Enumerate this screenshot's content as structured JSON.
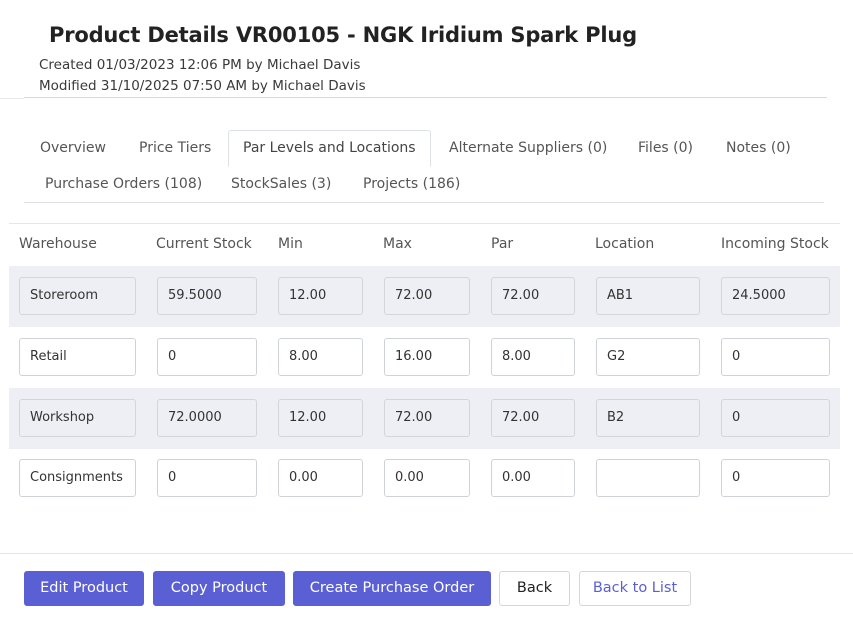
{
  "header": {
    "title": "Product Details VR00105 - NGK Iridium Spark Plug",
    "created": "Created 01/03/2023 12:06 PM by Michael Davis",
    "modified": "Modified 31/10/2025 07:50 AM by Michael Davis"
  },
  "tabs": [
    {
      "label": "Overview"
    },
    {
      "label": "Price Tiers"
    },
    {
      "label": "Par Levels and Locations",
      "active": true
    },
    {
      "label": "Alternate Suppliers (0)"
    },
    {
      "label": "Files (0)"
    },
    {
      "label": "Notes (0)"
    },
    {
      "label": "Purchase Orders (108)"
    },
    {
      "label": "StockSales (3)"
    },
    {
      "label": "Projects (186)"
    }
  ],
  "table": {
    "headers": [
      "Warehouse",
      "Current Stock",
      "Min",
      "Max",
      "Par",
      "Location",
      "Incoming Stock"
    ],
    "rows": [
      {
        "warehouse": "Storeroom",
        "current_stock": "59.5000",
        "min": "12.00",
        "max": "72.00",
        "par": "72.00",
        "location": "AB1",
        "incoming": "24.5000"
      },
      {
        "warehouse": "Retail",
        "current_stock": "0",
        "min": "8.00",
        "max": "16.00",
        "par": "8.00",
        "location": "G2",
        "incoming": "0"
      },
      {
        "warehouse": "Workshop",
        "current_stock": "72.0000",
        "min": "12.00",
        "max": "72.00",
        "par": "72.00",
        "location": "B2",
        "incoming": "0"
      },
      {
        "warehouse": "Consignments",
        "current_stock": "0",
        "min": "0.00",
        "max": "0.00",
        "par": "0.00",
        "location": "",
        "incoming": "0"
      }
    ]
  },
  "footer": {
    "edit_product": "Edit Product",
    "copy_product": "Copy Product",
    "create_po": "Create Purchase Order",
    "back": "Back",
    "back_to_list": "Back to List"
  },
  "colors": {
    "primary": "#5b5fd4",
    "row_shade": "#eeeff4"
  }
}
